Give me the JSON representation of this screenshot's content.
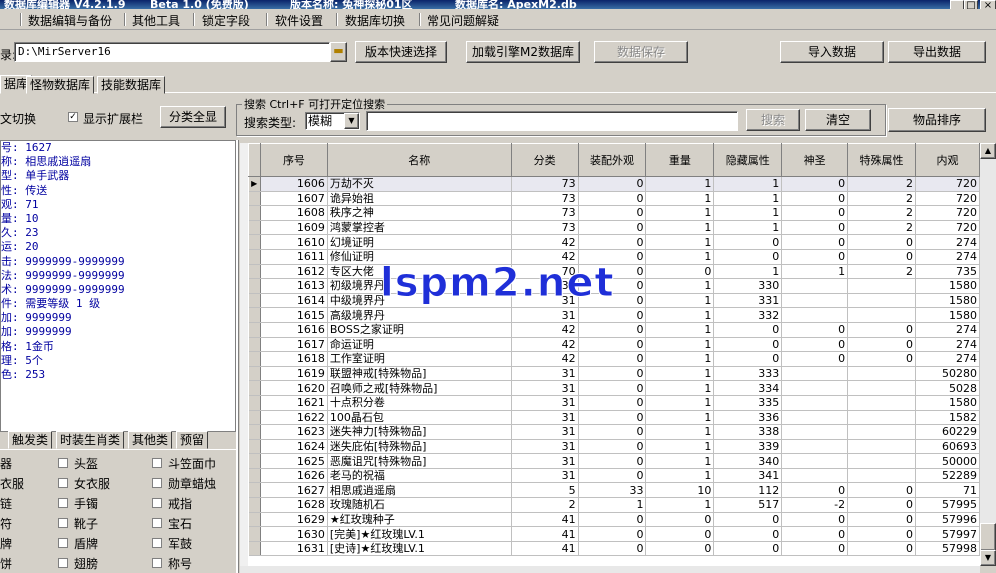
{
  "titlebar": {
    "app_title": "数据库编辑器 V4.2.1.9",
    "edition": "Beta 1.0 (免费版)",
    "version_name": "版本名称: 兔神探秘01区",
    "db_name": "数据库名: ApexM2.db"
  },
  "menu": [
    "数据编辑与备份",
    "其他工具",
    "锁定字段",
    "软件设置",
    "数据库切换",
    "常见问题解疑"
  ],
  "path": {
    "label": "录:",
    "value": "D:\\MirServer16"
  },
  "toolbar": {
    "quick_select": "版本快速选择",
    "load_engine": "加载引擎M2数据库",
    "save_data": "数据保存",
    "import": "导入数据",
    "export": "导出数据"
  },
  "tabs": [
    "据库",
    "怪物数据库",
    "技能数据库"
  ],
  "options": {
    "lang_switch": "文切换",
    "show_ext": "显示扩展栏",
    "expand_all": "分类全显",
    "show_ext_checked": "✓"
  },
  "search": {
    "title": "搜索  Ctrl+F 可打开定位搜索",
    "type_label": "搜索类型:",
    "type_value": "模糊",
    "button": "搜索",
    "clear": "清空",
    "sort": "物品排序"
  },
  "info": [
    "号: 1627",
    "称: 相思戚逍遥扇",
    "型: 单手武器",
    "性: 传送",
    "观: 71",
    "量: 10",
    "久: 23",
    "运: 20",
    "击: 9999999-9999999",
    "法: 9999999-9999999",
    "术: 9999999-9999999",
    "件: 需要等级 1 级",
    "加: 9999999",
    "加: 9999999",
    "格: 1金币",
    "理: 5个",
    "色: 253"
  ],
  "category_tabs": [
    "触发类",
    "时装生肖类",
    "其他类",
    "预留"
  ],
  "categories": [
    [
      "器",
      "头盔",
      "斗笠面巾"
    ],
    [
      "衣服",
      "女衣服",
      "勋章蜡烛"
    ],
    [
      "链",
      "手镯",
      "戒指"
    ],
    [
      "符",
      "靴子",
      "宝石"
    ],
    [
      "牌",
      "盾牌",
      "军鼓"
    ],
    [
      "饼",
      "翅膀",
      "称号"
    ]
  ],
  "grid": {
    "headers": [
      "序号",
      "名称",
      "分类",
      "装配外观",
      "重量",
      "隐藏属性",
      "神圣",
      "特殊属性",
      "内观"
    ],
    "rows": [
      [
        "1606",
        "万劫不灭",
        "73",
        "0",
        "1",
        "1",
        "0",
        "2",
        "720"
      ],
      [
        "1607",
        "诡异始祖",
        "73",
        "0",
        "1",
        "1",
        "0",
        "2",
        "720"
      ],
      [
        "1608",
        "秩序之神",
        "73",
        "0",
        "1",
        "1",
        "0",
        "2",
        "720"
      ],
      [
        "1609",
        "鸿蒙掌控者",
        "73",
        "0",
        "1",
        "1",
        "0",
        "2",
        "720"
      ],
      [
        "1610",
        "幻境证明",
        "42",
        "0",
        "1",
        "0",
        "0",
        "0",
        "274"
      ],
      [
        "1611",
        "修仙证明",
        "42",
        "0",
        "1",
        "0",
        "0",
        "0",
        "274"
      ],
      [
        "1612",
        "专区大佬",
        "70",
        "0",
        "0",
        "1",
        "1",
        "2",
        "735"
      ],
      [
        "1613",
        "初级境界丹",
        "31",
        "0",
        "1",
        "330",
        "",
        "",
        "1580"
      ],
      [
        "1614",
        "中级境界丹",
        "31",
        "0",
        "1",
        "331",
        "",
        "",
        "1580"
      ],
      [
        "1615",
        "高级境界丹",
        "31",
        "0",
        "1",
        "332",
        "",
        "",
        "1580"
      ],
      [
        "1616",
        "BOSS之家证明",
        "42",
        "0",
        "1",
        "0",
        "0",
        "0",
        "274"
      ],
      [
        "1617",
        "命运证明",
        "42",
        "0",
        "1",
        "0",
        "0",
        "0",
        "274"
      ],
      [
        "1618",
        "工作室证明",
        "42",
        "0",
        "1",
        "0",
        "0",
        "0",
        "274"
      ],
      [
        "1619",
        "联盟神戒[特殊物品]",
        "31",
        "0",
        "1",
        "333",
        "",
        "",
        "50280"
      ],
      [
        "1620",
        "召唤师之戒[特殊物品]",
        "31",
        "0",
        "1",
        "334",
        "",
        "",
        "5028"
      ],
      [
        "1621",
        "十点积分卷",
        "31",
        "0",
        "1",
        "335",
        "",
        "",
        "1580"
      ],
      [
        "1622",
        "100晶石包",
        "31",
        "0",
        "1",
        "336",
        "",
        "",
        "1582"
      ],
      [
        "1623",
        "迷失神力[特殊物品]",
        "31",
        "0",
        "1",
        "338",
        "",
        "",
        "60229"
      ],
      [
        "1624",
        "迷失庇佑[特殊物品]",
        "31",
        "0",
        "1",
        "339",
        "",
        "",
        "60693"
      ],
      [
        "1625",
        "恶魔诅咒[特殊物品]",
        "31",
        "0",
        "1",
        "340",
        "",
        "",
        "50000"
      ],
      [
        "1626",
        "老马的祝福",
        "31",
        "0",
        "1",
        "341",
        "",
        "",
        "52289"
      ],
      [
        "1627",
        "相思戚逍遥扇",
        "5",
        "33",
        "10",
        "112",
        "0",
        "0",
        "71"
      ],
      [
        "1628",
        "玫瑰随机石",
        "2",
        "1",
        "1",
        "517",
        "-2",
        "0",
        "57995"
      ],
      [
        "1629",
        "★红玫瑰种子",
        "41",
        "0",
        "0",
        "0",
        "0",
        "0",
        "57996"
      ],
      [
        "1630",
        "[完美]★红玫瑰LV.1",
        "41",
        "0",
        "0",
        "0",
        "0",
        "0",
        "57997"
      ],
      [
        "1631",
        "[史诗]★红玫瑰LV.1",
        "41",
        "0",
        "0",
        "0",
        "0",
        "0",
        "57998"
      ]
    ]
  },
  "watermark": "lspm2.net",
  "icons": {
    "folder": "folder-icon",
    "dropdown": "chevron-down-icon",
    "current_row": "row-pointer-icon"
  }
}
